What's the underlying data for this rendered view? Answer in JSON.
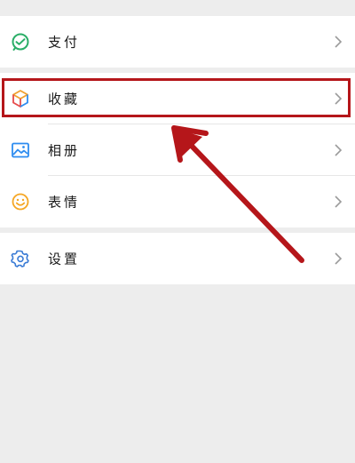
{
  "menu": {
    "pay": {
      "label": "支付",
      "icon": "wechat-pay-icon"
    },
    "favorites": {
      "label": "收藏",
      "icon": "favorites-cube-icon"
    },
    "album": {
      "label": "相册",
      "icon": "album-image-icon"
    },
    "stickers": {
      "label": "表情",
      "icon": "sticker-smile-icon"
    },
    "settings": {
      "label": "设置",
      "icon": "settings-gear-icon"
    }
  },
  "colors": {
    "highlight": "#b5161a",
    "pay_green": "#2aae67",
    "album_blue": "#2d8cf0",
    "sticker_orange": "#f5a623",
    "settings_blue": "#3a7bd5"
  }
}
